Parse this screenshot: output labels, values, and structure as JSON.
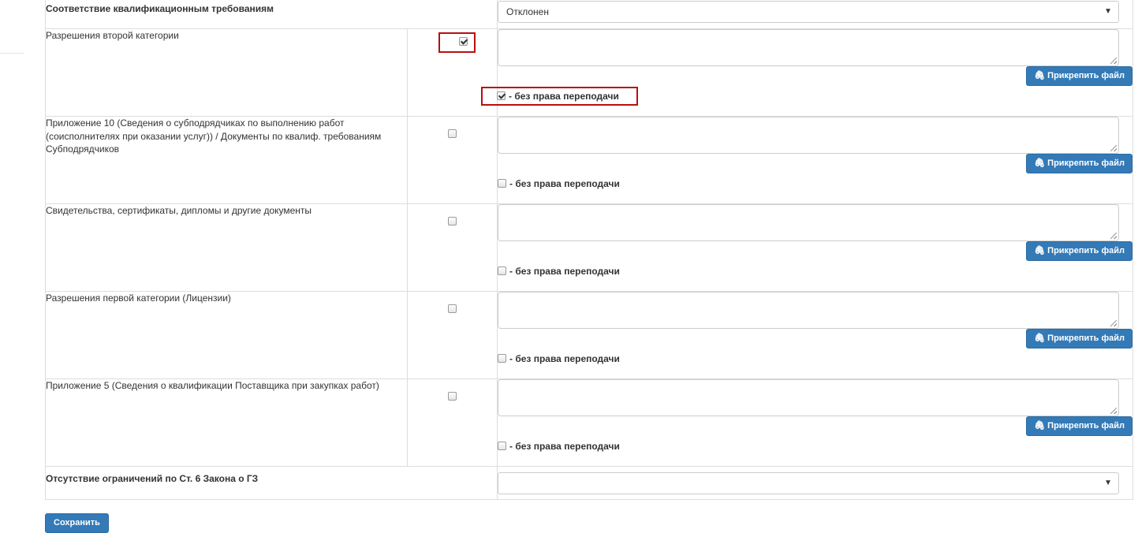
{
  "form": {
    "qualification": {
      "label": "Соответствие квалификационным требованиям",
      "select_value": "Отклонен"
    },
    "restrictions": {
      "label": "Отсутствие ограничений по Ст. 6 Закона о ГЗ",
      "select_value": ""
    },
    "documents": [
      {
        "label": "Разрешения второй категории",
        "checked": true,
        "no_transfer_checked": true
      },
      {
        "label": "Приложение 10 (Сведения о субподрядчиках по выполнению работ (соисполнителях при оказании услуг)) / Документы по квалиф. требованиям Субподрядчиков",
        "checked": false,
        "no_transfer_checked": false
      },
      {
        "label": "Свидетельства, сертификаты, дипломы и другие документы",
        "checked": false,
        "no_transfer_checked": false
      },
      {
        "label": "Разрешения первой категории (Лицензии)",
        "checked": false,
        "no_transfer_checked": false
      },
      {
        "label": "Приложение 5 (Сведения о квалификации Поставщика при закупках работ)",
        "checked": false,
        "no_transfer_checked": false
      }
    ],
    "attach_label": "Прикрепить файл",
    "no_transfer_label": "- без права переподачи",
    "select_caret": "▼",
    "attach_icon": "paperclip-icon",
    "save_label": "Сохранить"
  },
  "colors": {
    "primary": "#337ab7",
    "highlight": "#b80f0f",
    "border": "#dddddd"
  }
}
